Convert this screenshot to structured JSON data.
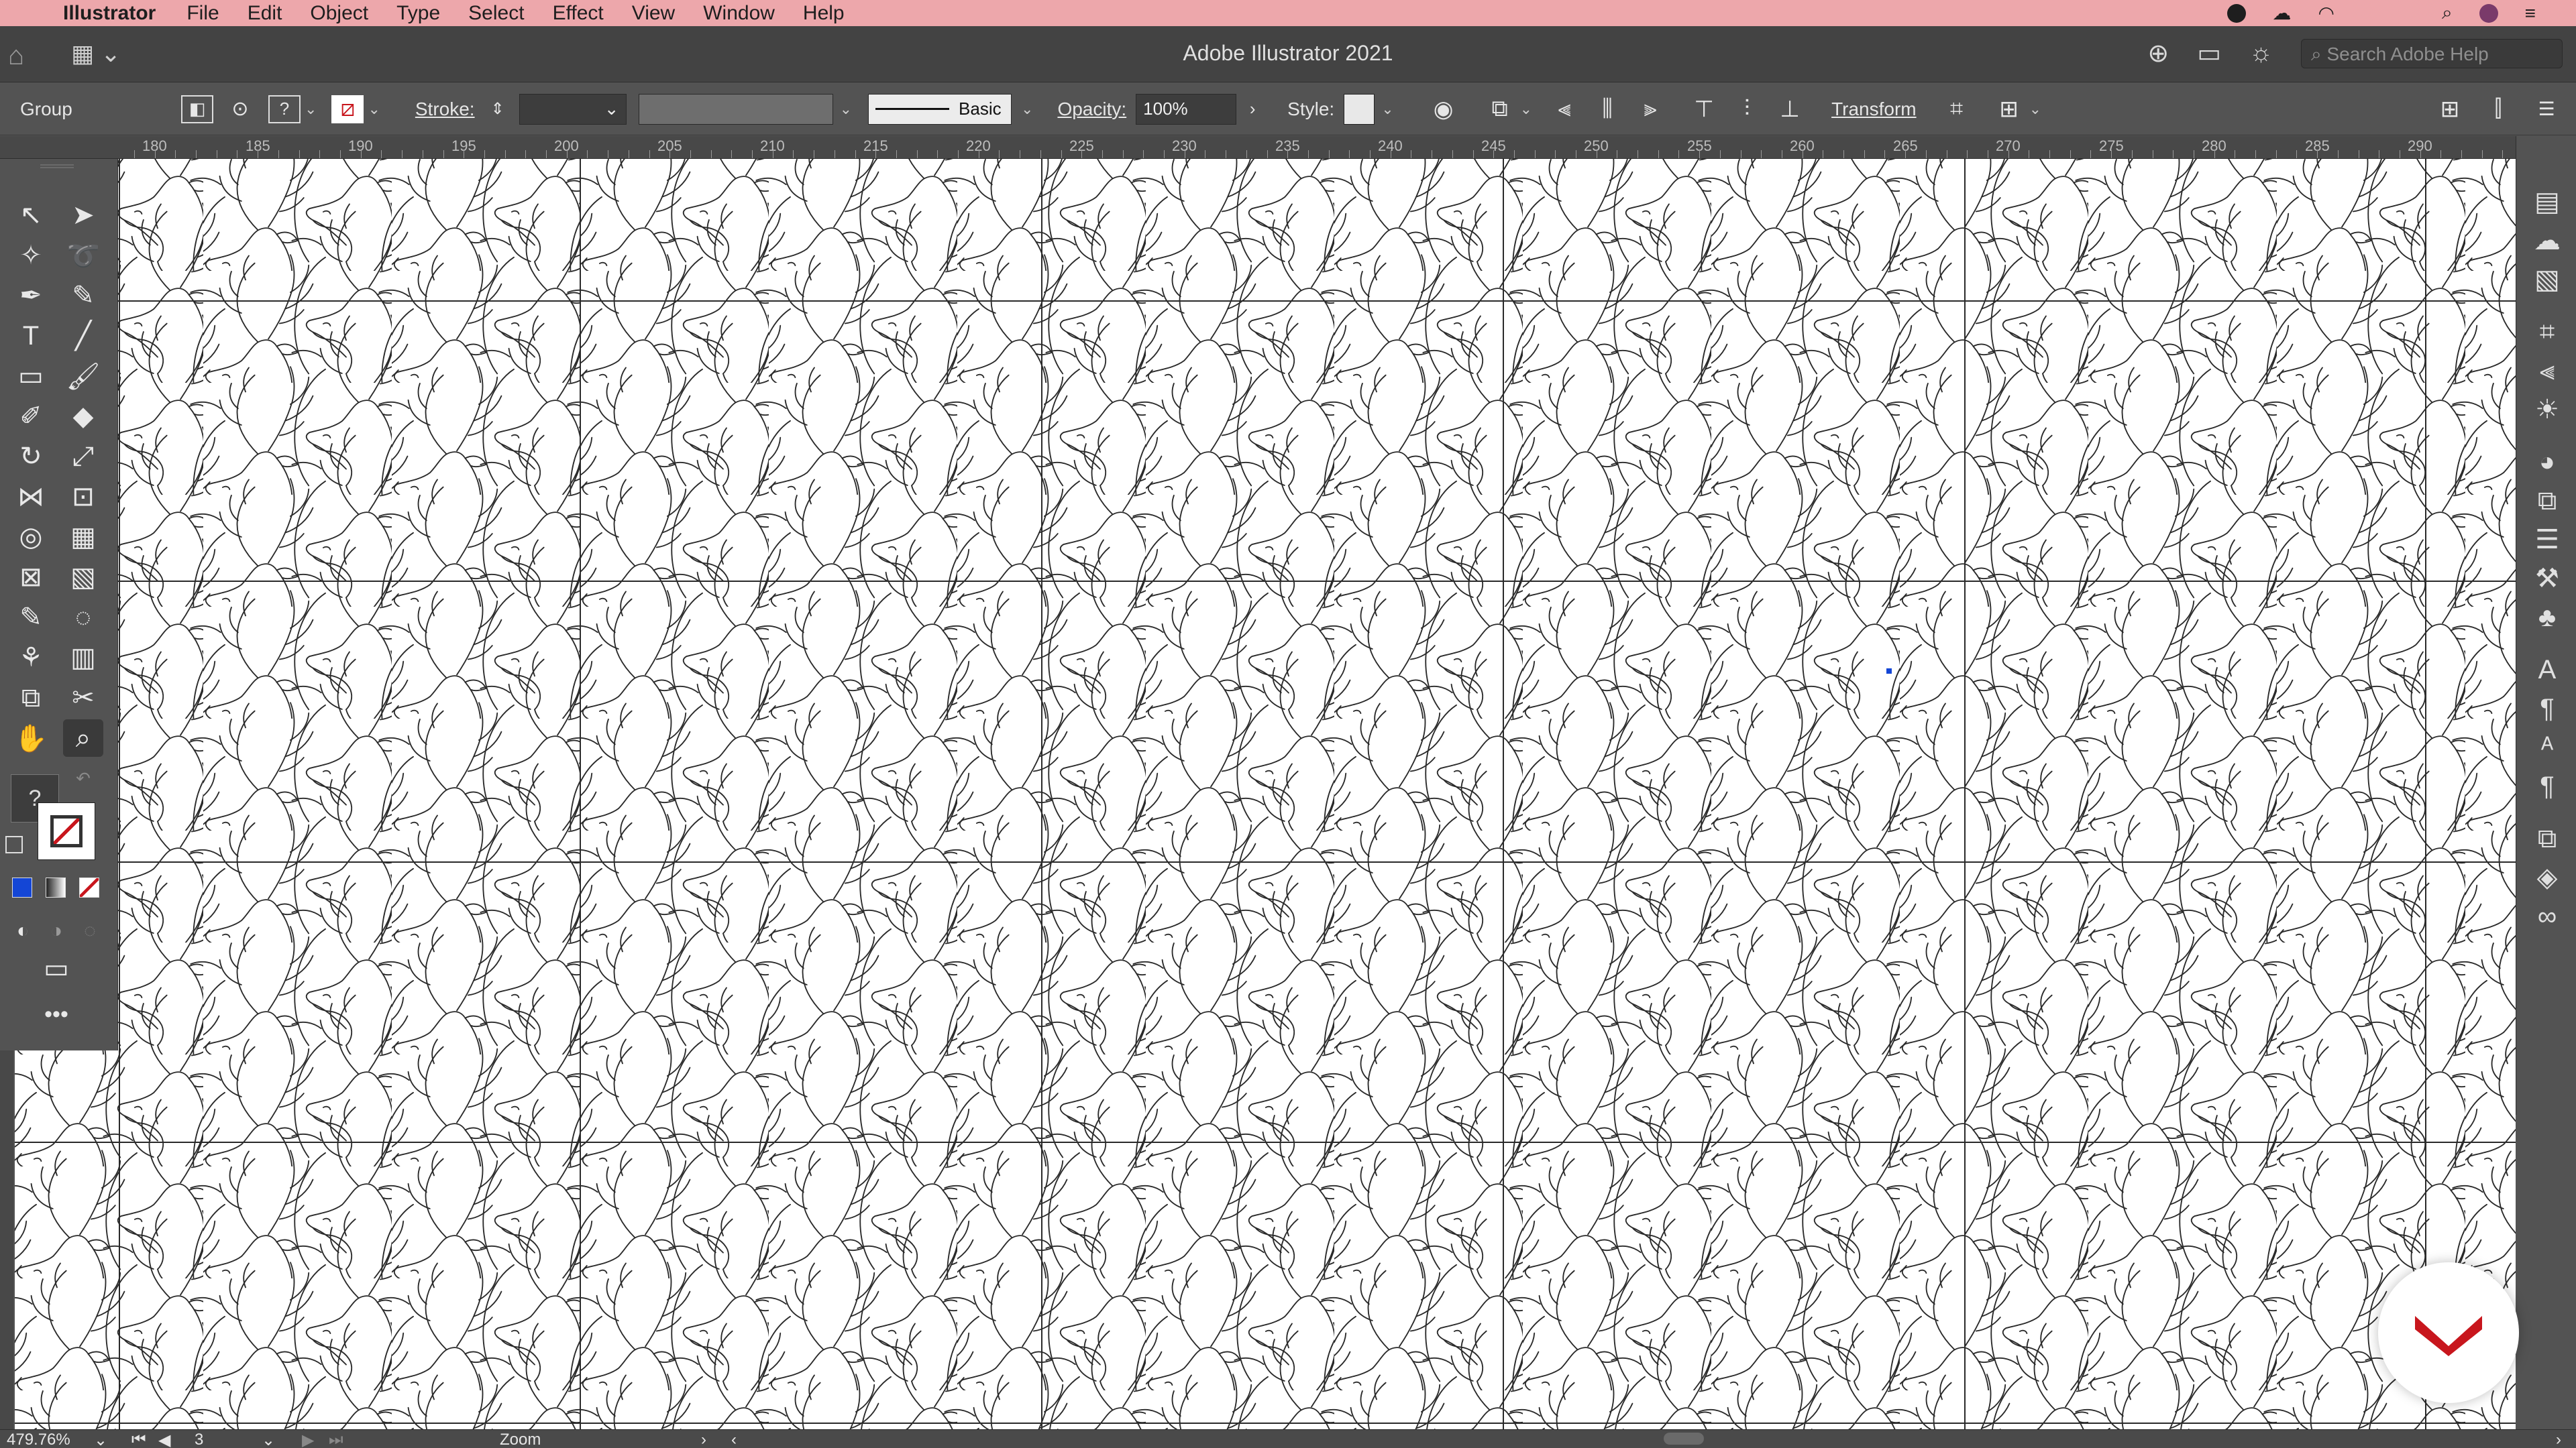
{
  "menubar": {
    "app_name": "Illustrator",
    "items": [
      "File",
      "Edit",
      "Object",
      "Type",
      "Select",
      "Effect",
      "View",
      "Window",
      "Help"
    ]
  },
  "titlebar": {
    "title": "Adobe Illustrator 2021",
    "search_placeholder": "Search Adobe Help"
  },
  "control_bar": {
    "selection_label": "Group",
    "stroke_label": "Stroke:",
    "brush_label": "Basic",
    "opacity_label": "Opacity:",
    "opacity_value": "100%",
    "style_label": "Style:",
    "transform_label": "Transform"
  },
  "ruler": {
    "ticks": [
      "180",
      "185",
      "190",
      "195",
      "200",
      "205",
      "210",
      "215",
      "220",
      "225",
      "230",
      "235",
      "240",
      "245",
      "250",
      "255",
      "260",
      "265",
      "270",
      "275",
      "280",
      "285",
      "290"
    ]
  },
  "status_bar": {
    "zoom": "479.76%",
    "artboard": "3",
    "tool_name": "Zoom"
  },
  "colors": {
    "menubar_bg": "#eda7ab",
    "app_bg": "#535353",
    "canvas_bg": "#ffffff",
    "accent_red": "#c8161d",
    "fill_blue": "#1446d6"
  }
}
